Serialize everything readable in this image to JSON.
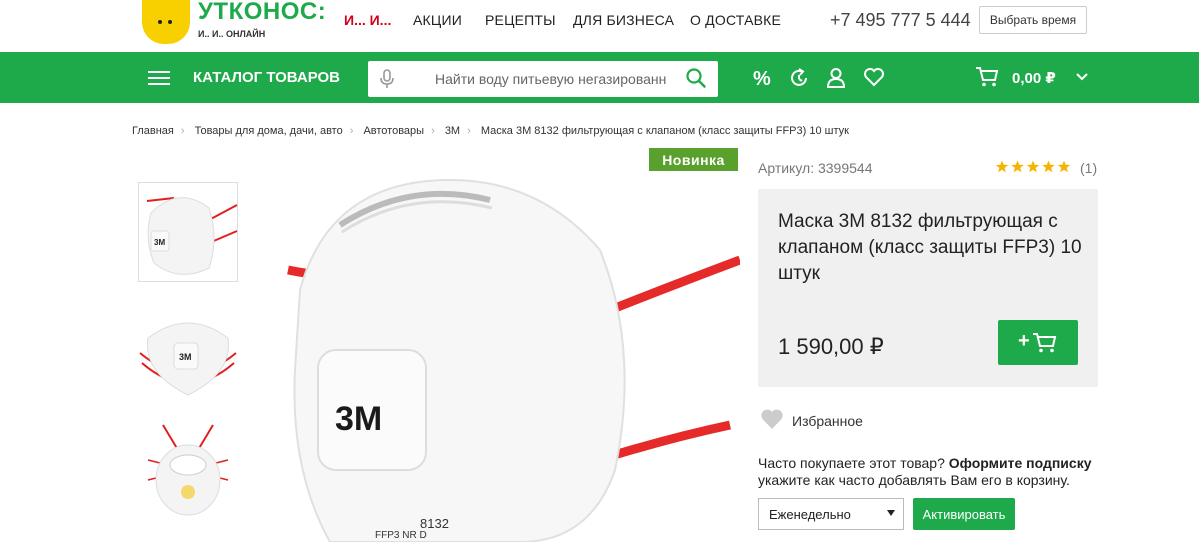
{
  "header": {
    "logo_text": "УТКОНОС:",
    "logo_sub": "И.. И.. ОНЛАЙН",
    "promo_link": "И... И...",
    "nav": [
      "АКЦИИ",
      "РЕЦЕПТЫ",
      "ДЛЯ БИЗНЕСА",
      "О ДОСТАВКЕ"
    ],
    "phone": "+7 495 777 5 444",
    "time_button": "Выбрать время"
  },
  "bar": {
    "catalog": "КАТАЛОГ ТОВАРОВ",
    "search_placeholder": "Найти воду питьевую негазированн",
    "cart_total": "0,00 ₽",
    "brand_color": "#1eaa4a"
  },
  "breadcrumbs": [
    "Главная",
    "Товары для дома, дачи, авто",
    "Автотовары",
    "3M",
    "Маска 3М 8132 фильтрующая с клапаном (класс защиты FFP3) 10 штук"
  ],
  "product": {
    "badge": "Новинка",
    "article": "Артикул: 3399544",
    "rating_stars": 5,
    "rating_count": "(1)",
    "title": "Маска 3М 8132 фильтрующая с клапаном (класс защиты FFP3) 10 штук",
    "price": "1 590,00 ₽",
    "add_label": "+",
    "favorite": "Избранное",
    "sub_prefix": "Часто покупаете этот товар?",
    "sub_bold": "Оформите подписку",
    "sub_line2": "укажите как часто добавлять Вам его в корзину.",
    "frequency": "Еженедельно",
    "activate": "Активировать",
    "image_brand": "3M",
    "image_model": "8132",
    "image_class": "FFP3 NR D"
  }
}
